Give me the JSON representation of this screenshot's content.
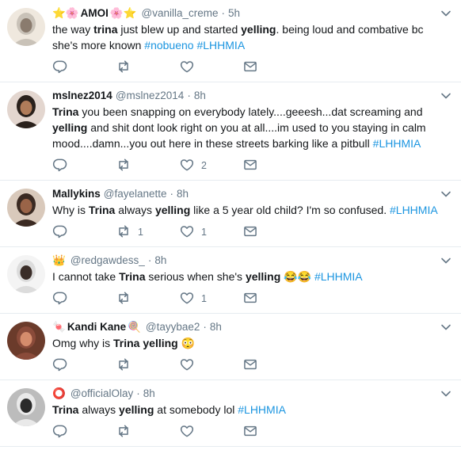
{
  "tweets": [
    {
      "name": "AMOI",
      "name_prefix": "⭐🌸",
      "name_suffix": "🌸⭐",
      "handle": "@vanilla_creme",
      "time": "5h",
      "text": [
        {
          "t": "the way "
        },
        {
          "t": "trina",
          "b": true
        },
        {
          "t": " just blew up and started "
        },
        {
          "t": "yelling",
          "b": true
        },
        {
          "t": ". being loud and combative bc she's more known "
        },
        {
          "t": "#nobueno",
          "tag": true
        },
        {
          "t": " "
        },
        {
          "t": "#LHHMIA",
          "tag": true
        }
      ],
      "retweets": "",
      "likes": ""
    },
    {
      "name": "mslnez2014",
      "handle": "@mslnez2014",
      "time": "8h",
      "text": [
        {
          "t": "Trina",
          "b": true
        },
        {
          "t": " you been snapping on everybody lately....geeesh...dat screaming and "
        },
        {
          "t": "yelling",
          "b": true
        },
        {
          "t": " and shit dont look right on you at all....im used to you staying in calm mood....damn...you out here in these streets barking like a pitbull "
        },
        {
          "t": "#LHHMIA",
          "tag": true
        }
      ],
      "retweets": "",
      "likes": "2"
    },
    {
      "name": "Mallykins",
      "handle": "@fayelanette",
      "time": "8h",
      "text": [
        {
          "t": "Why is "
        },
        {
          "t": "Trina",
          "b": true
        },
        {
          "t": " always "
        },
        {
          "t": "yelling",
          "b": true
        },
        {
          "t": " like a 5 year old child? I'm so confused. "
        },
        {
          "t": "#LHHMIA",
          "tag": true
        }
      ],
      "retweets": "1",
      "likes": "1"
    },
    {
      "name": "",
      "name_prefix": "👑",
      "handle": "@redgawdess_",
      "time": "8h",
      "text": [
        {
          "t": "I cannot take "
        },
        {
          "t": "Trina",
          "b": true
        },
        {
          "t": " serious when she's "
        },
        {
          "t": "yelling",
          "b": true
        },
        {
          "t": " 😂😂 "
        },
        {
          "t": "#LHHMIA",
          "tag": true
        }
      ],
      "retweets": "",
      "likes": "1"
    },
    {
      "name": "Kandi Kane",
      "name_prefix": "🍬",
      "name_suffix": "🍭",
      "handle": "@tayybae2",
      "time": "8h",
      "text": [
        {
          "t": "Omg why is "
        },
        {
          "t": "Trina",
          "b": true
        },
        {
          "t": " "
        },
        {
          "t": "yelling",
          "b": true
        },
        {
          "t": " 😳"
        }
      ],
      "retweets": "",
      "likes": ""
    },
    {
      "name": "",
      "name_prefix": "⭕",
      "handle": "@officialOlay",
      "time": "8h",
      "text": [
        {
          "t": "Trina",
          "b": true
        },
        {
          "t": " always "
        },
        {
          "t": "yelling",
          "b": true
        },
        {
          "t": " at somebody lol "
        },
        {
          "t": "#LHHMIA",
          "tag": true
        }
      ],
      "retweets": "",
      "likes": ""
    }
  ],
  "colors": {
    "link": "#1b95e0",
    "muted": "#657786",
    "divider": "#e6ecf0",
    "text": "#14171a"
  },
  "icons": {
    "reply": "reply-icon",
    "retweet": "retweet-icon",
    "like": "heart-icon",
    "dm": "envelope-icon",
    "menu": "chevron-down-icon"
  }
}
